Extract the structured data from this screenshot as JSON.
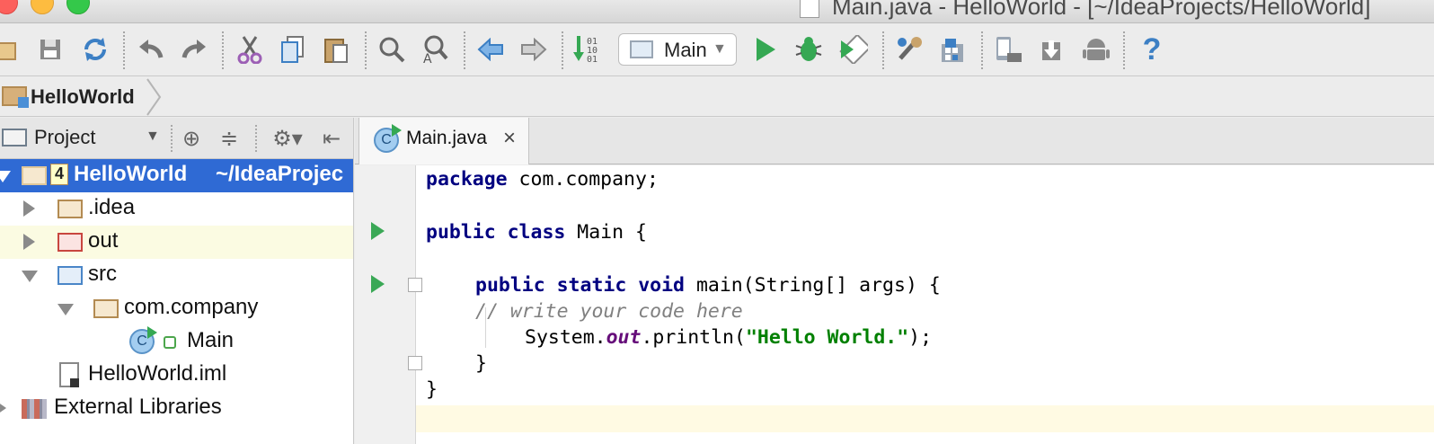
{
  "window": {
    "title": "Main.java - HelloWorld - [~/IdeaProjects/HelloWorld]"
  },
  "toolbar": {
    "run_config": "Main",
    "icons": [
      "open-icon",
      "save-icon",
      "sync-icon",
      "undo-icon",
      "redo-icon",
      "cut-icon",
      "copy-icon",
      "paste-icon",
      "find-icon",
      "replace-icon",
      "back-icon",
      "forward-icon",
      "make-icon",
      "run-icon",
      "debug-icon",
      "coverage-icon",
      "project-structure-icon",
      "sdk-manager-icon",
      "avd-manager-icon",
      "device-icon",
      "android-icon",
      "help-icon"
    ]
  },
  "navbar": {
    "breadcrumb": "HelloWorld"
  },
  "project_panel": {
    "title": "Project",
    "tree": [
      {
        "label": "HelloWorld",
        "path": "~/IdeaProjec",
        "badge": "4"
      },
      {
        "label": ".idea"
      },
      {
        "label": "out"
      },
      {
        "label": "src"
      },
      {
        "label": "com.company"
      },
      {
        "label": "Main"
      },
      {
        "label": "HelloWorld.iml"
      },
      {
        "label": "External Libraries"
      }
    ]
  },
  "editor": {
    "tab_label": "Main.java",
    "tab_close": "×",
    "code": {
      "l1_kw": "package",
      "l1_rest": " com.company;",
      "l3_kw": "public class",
      "l3_rest": " Main {",
      "l5_kw": "public static void",
      "l5_rest": " main(String[] args) {",
      "l6_comment": "// write your code here",
      "l7_a": "System.",
      "l7_field": "out",
      "l7_b": ".println(",
      "l7_str": "\"Hello World.\"",
      "l7_c": ");",
      "l8": "}",
      "l9": "}"
    }
  },
  "colors": {
    "selection": "#2f6ad4",
    "keyword": "#000080",
    "string": "#008000",
    "field": "#660e7a",
    "comment": "#808080",
    "run_green": "#35a853"
  }
}
